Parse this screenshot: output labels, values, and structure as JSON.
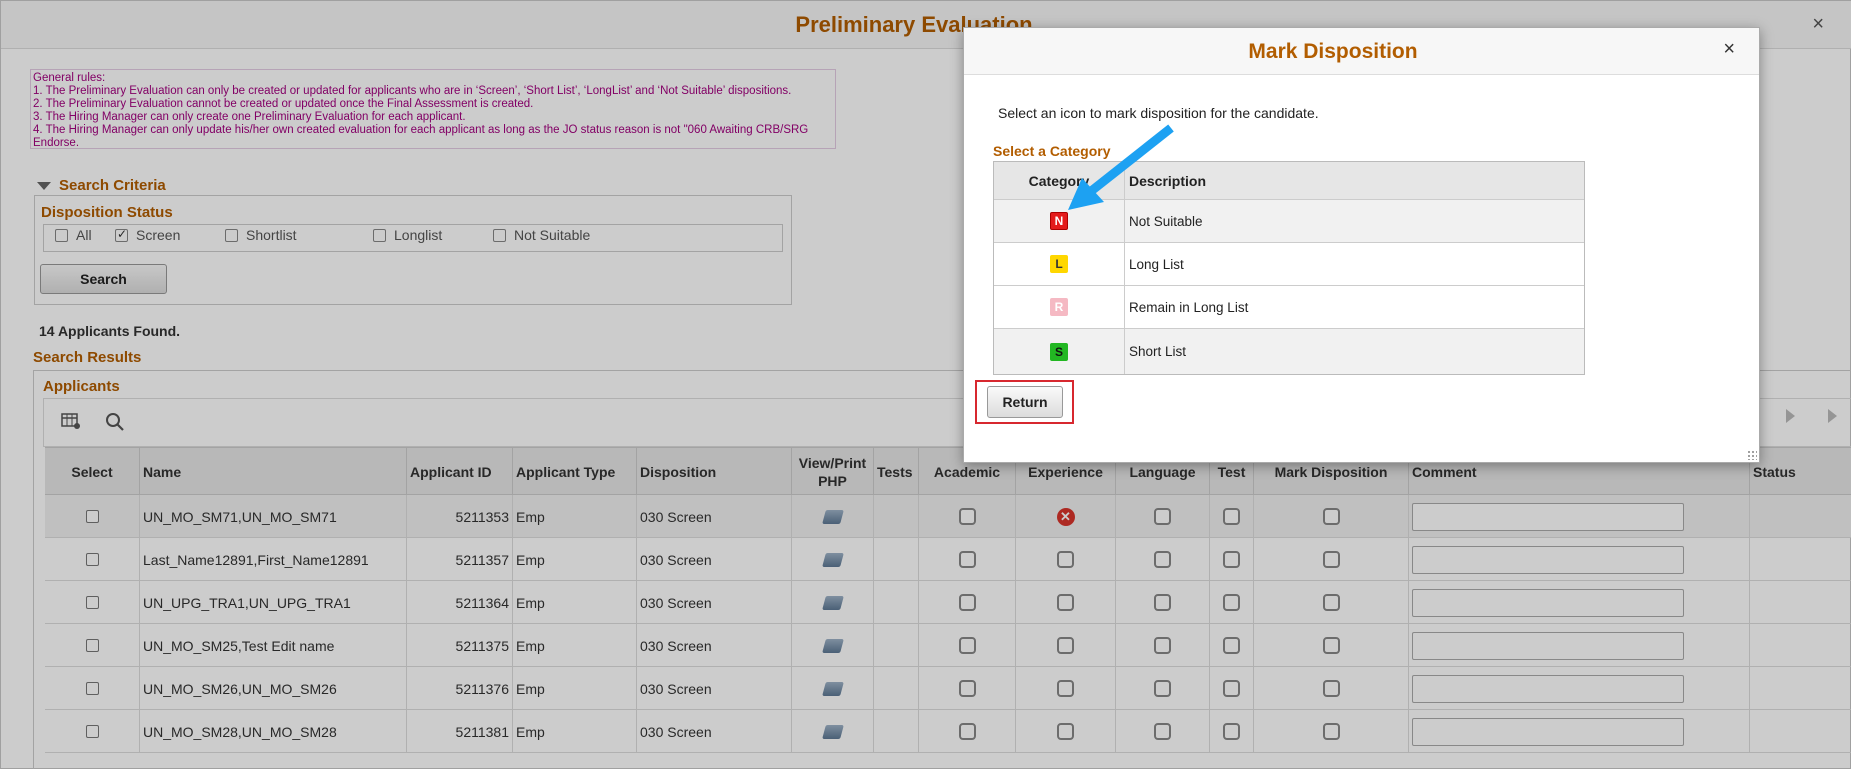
{
  "page": {
    "title": "Preliminary Evaluation",
    "close_symbol": "×",
    "rules": [
      "General rules:",
      "1. The Preliminary Evaluation can only be created or updated for applicants who are in ‘Screen’, ‘Short List’, ‘LongList’ and ‘Not Suitable’ dispositions.",
      "2. The Preliminary Evaluation cannot be created or updated once the Final Assessment is created.",
      "3. The Hiring Manager can only create one Preliminary Evaluation for each applicant.",
      "4. The Hiring Manager can only update his/her own created evaluation for each applicant as long as the JO status reason is not \"060 Awaiting CRB/SRG Endorse."
    ]
  },
  "search": {
    "criteria_label": "Search Criteria",
    "status_label": "Disposition Status",
    "options": [
      {
        "label": "All",
        "checked": false
      },
      {
        "label": "Screen",
        "checked": true
      },
      {
        "label": "Shortlist",
        "checked": false
      },
      {
        "label": "Longlist",
        "checked": false
      },
      {
        "label": "Not Suitable",
        "checked": false
      }
    ],
    "button_label": "Search"
  },
  "results": {
    "count_text": "14 Applicants Found.",
    "section_label": "Search Results",
    "grid_label": "Applicants",
    "toolbar_icons": [
      "grid-settings-icon",
      "search-icon"
    ],
    "columns": [
      "Select",
      "Name",
      "Applicant ID",
      "Applicant Type",
      "Disposition",
      "View/Print PHP",
      "Tests",
      "Academic",
      "Experience",
      "Language",
      "Test",
      "Mark Disposition",
      "Comment",
      "Status"
    ],
    "rows": [
      {
        "name": "UN_MO_SM71,UN_MO_SM71",
        "id": "5211353",
        "type": "Emp",
        "disposition": "030 Screen",
        "experience_icon": "error-icon"
      },
      {
        "name": "Last_Name12891,First_Name12891",
        "id": "5211357",
        "type": "Emp",
        "disposition": "030 Screen",
        "experience_icon": "checkbox-icon"
      },
      {
        "name": "UN_UPG_TRA1,UN_UPG_TRA1",
        "id": "5211364",
        "type": "Emp",
        "disposition": "030 Screen",
        "experience_icon": "checkbox-icon"
      },
      {
        "name": "UN_MO_SM25,Test Edit name",
        "id": "5211375",
        "type": "Emp",
        "disposition": "030 Screen",
        "experience_icon": "checkbox-icon"
      },
      {
        "name": "UN_MO_SM26,UN_MO_SM26",
        "id": "5211376",
        "type": "Emp",
        "disposition": "030 Screen",
        "experience_icon": "checkbox-icon"
      },
      {
        "name": "UN_MO_SM28,UN_MO_SM28",
        "id": "5211381",
        "type": "Emp",
        "disposition": "030 Screen",
        "experience_icon": "checkbox-icon"
      }
    ]
  },
  "modal": {
    "title": "Mark Disposition",
    "close_symbol": "×",
    "instruction": "Select an icon to mark disposition for the candidate.",
    "category_label": "Select a Category",
    "headers": {
      "category": "Category",
      "description": "Description"
    },
    "categories": [
      {
        "letter": "N",
        "description": "Not Suitable",
        "bg": "#e41b1b",
        "fg": "#ffffff"
      },
      {
        "letter": "L",
        "description": "Long List",
        "bg": "#ffd700",
        "fg": "#333333"
      },
      {
        "letter": "R",
        "description": "Remain in Long List",
        "bg": "#f5b9c3",
        "fg": "#ffffff"
      },
      {
        "letter": "S",
        "description": "Short List",
        "bg": "#22b722",
        "fg": "#111111"
      }
    ],
    "return_label": "Return"
  },
  "colors": {
    "accent": "#b25d00",
    "rules_text": "#a3007f",
    "highlight_frame": "#d7282f",
    "annotation_arrow": "#1da1f2"
  }
}
